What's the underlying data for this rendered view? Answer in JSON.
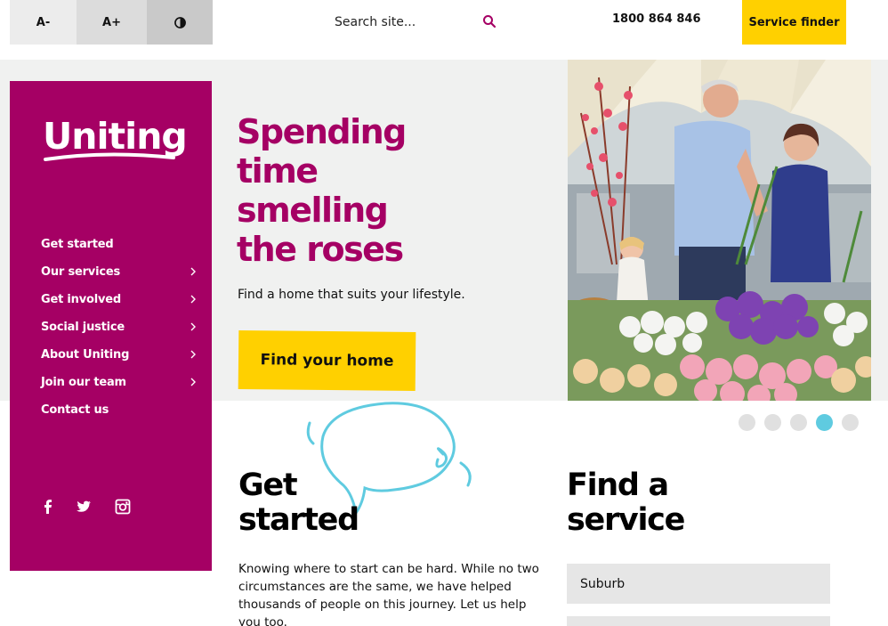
{
  "accessibility": {
    "decrease_label": "A-",
    "increase_label": "A+",
    "contrast_icon": "contrast-icon"
  },
  "search": {
    "placeholder": "Search site...",
    "icon": "search-icon"
  },
  "header": {
    "phone": "1800 864 846",
    "service_finder_label": "Service finder"
  },
  "brand": {
    "logo_text": "Uniting",
    "primary_color": "#a50064",
    "accent_color": "#ffd000",
    "highlight_color": "#5fcbe0"
  },
  "sidebar": {
    "items": [
      {
        "label": "Get started",
        "has_submenu": false
      },
      {
        "label": "Our services",
        "has_submenu": true
      },
      {
        "label": "Get involved",
        "has_submenu": true
      },
      {
        "label": "Social justice",
        "has_submenu": true
      },
      {
        "label": "About Uniting",
        "has_submenu": true
      },
      {
        "label": "Join our team",
        "has_submenu": true
      },
      {
        "label": "Contact us",
        "has_submenu": false
      }
    ],
    "social": [
      "facebook-icon",
      "twitter-icon",
      "instagram-icon"
    ]
  },
  "hero": {
    "headline_lines": [
      "Spending",
      "time",
      "smelling",
      "the roses"
    ],
    "subtitle": "Find a home that suits your lifestyle.",
    "cta_label": "Find your home"
  },
  "carousel": {
    "slide_count": 5,
    "active_index": 3
  },
  "get_started": {
    "title_lines": [
      "Get",
      "started"
    ],
    "body": "Knowing where to start can be hard. While no two circumstances are the same, we have helped thousands of people on this journey. Let us help you too."
  },
  "find_service": {
    "title_lines": [
      "Find a",
      "service"
    ],
    "suburb_placeholder": "Suburb"
  }
}
